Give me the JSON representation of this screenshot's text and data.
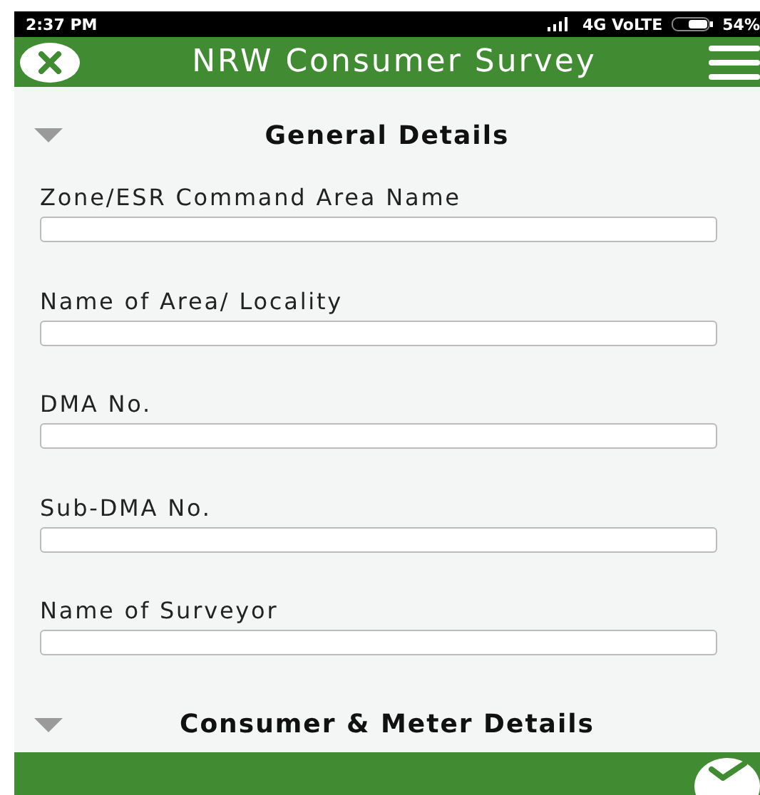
{
  "status_bar": {
    "time": "2:37 PM",
    "network": "4G VoLTE",
    "battery": "54%"
  },
  "header": {
    "title": "NRW Consumer Survey"
  },
  "sections": [
    {
      "title": "General Details",
      "expanded": true,
      "fields": [
        {
          "label": "Zone/ESR Command Area Name"
        },
        {
          "label": "Name of Area/ Locality"
        },
        {
          "label": "DMA No."
        },
        {
          "label": "Sub-DMA No."
        },
        {
          "label": "Name of Surveyor"
        }
      ]
    },
    {
      "title": "Consumer & Meter Details",
      "expanded": true
    }
  ]
}
